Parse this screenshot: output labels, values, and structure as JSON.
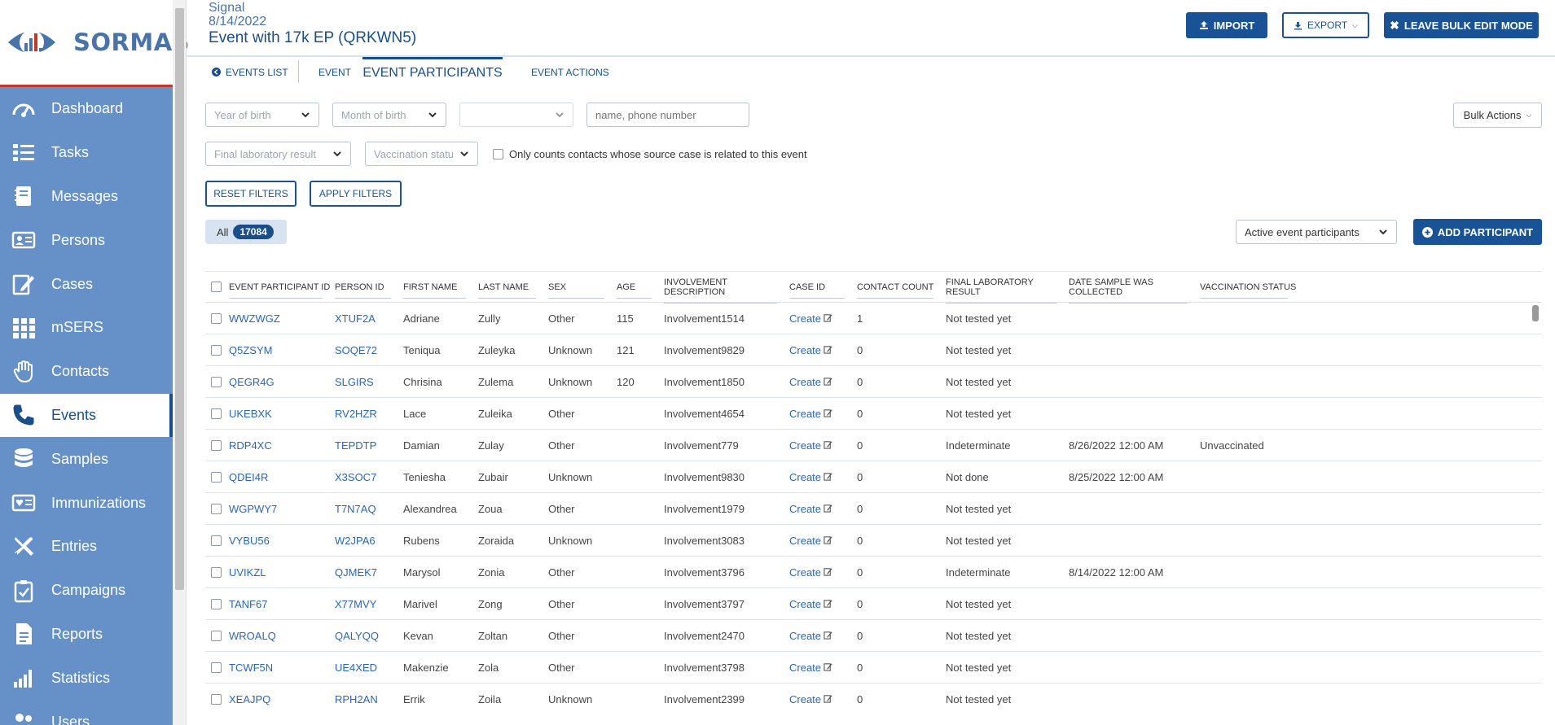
{
  "app": {
    "logo_text": "SORMAS"
  },
  "sidebar": {
    "items": [
      {
        "label": "Dashboard",
        "icon": "gauge-icon"
      },
      {
        "label": "Tasks",
        "icon": "task-list-icon"
      },
      {
        "label": "Messages",
        "icon": "notebook-icon"
      },
      {
        "label": "Persons",
        "icon": "id-card-icon"
      },
      {
        "label": "Cases",
        "icon": "edit-document-icon"
      },
      {
        "label": "mSERS",
        "icon": "grid-icon"
      },
      {
        "label": "Contacts",
        "icon": "hand-icon"
      },
      {
        "label": "Events",
        "icon": "phone-icon"
      },
      {
        "label": "Samples",
        "icon": "database-icon"
      },
      {
        "label": "Immunizations",
        "icon": "heart-card-icon"
      },
      {
        "label": "Entries",
        "icon": "airplane-icon"
      },
      {
        "label": "Campaigns",
        "icon": "clipboard-check-icon"
      },
      {
        "label": "Reports",
        "icon": "report-document-icon"
      },
      {
        "label": "Statistics",
        "icon": "bar-chart-icon"
      },
      {
        "label": "Users",
        "icon": "users-icon"
      }
    ],
    "active_index": 7
  },
  "header": {
    "subtitle_type": "Signal",
    "subtitle_date": "8/14/2022",
    "title": "Event with 17k EP (QRKWN5)",
    "import_label": "IMPORT",
    "export_label": "EXPORT",
    "leave_bulk_label": "LEAVE BULK EDIT MODE"
  },
  "tabs": {
    "events_list": "EVENTS LIST",
    "event": "EVENT",
    "event_participants": "EVENT PARTICIPANTS",
    "event_actions": "EVENT ACTIONS"
  },
  "filters": {
    "year_of_birth": "Year of birth",
    "month_of_birth": "Month of birth",
    "day_of_birth": "",
    "search_placeholder": "name, phone number",
    "bulk_actions": "Bulk Actions",
    "final_lab_result": "Final laboratory result",
    "vaccination_status": "Vaccination statu",
    "only_counts_label": "Only counts contacts whose source case is related to this event",
    "reset_label": "RESET FILTERS",
    "apply_label": "APPLY FILTERS",
    "all_label": "All",
    "all_count": "17084",
    "participant_scope": "Active event participants",
    "add_participant_label": "ADD PARTICIPANT"
  },
  "table": {
    "columns": [
      "EVENT PARTICIPANT ID",
      "PERSON ID",
      "FIRST NAME",
      "LAST NAME",
      "SEX",
      "AGE",
      "INVOLVEMENT DESCRIPTION",
      "CASE ID",
      "CONTACT COUNT",
      "FINAL LABORATORY RESULT",
      "DATE SAMPLE WAS COLLECTED",
      "VACCINATION STATUS"
    ],
    "rows": [
      [
        "WWZWGZ",
        "XTUF2A",
        "Adriane",
        "Zully",
        "Other",
        "115",
        "Involvement1514",
        "Create",
        "1",
        "Not tested yet",
        "",
        ""
      ],
      [
        "Q5ZSYM",
        "SOQE72",
        "Teniqua",
        "Zuleyka",
        "Unknown",
        "121",
        "Involvement9829",
        "Create",
        "0",
        "Not tested yet",
        "",
        ""
      ],
      [
        "QEGR4G",
        "SLGIRS",
        "Chrisina",
        "Zulema",
        "Unknown",
        "120",
        "Involvement1850",
        "Create",
        "0",
        "Not tested yet",
        "",
        ""
      ],
      [
        "UKEBXK",
        "RV2HZR",
        "Lace",
        "Zuleika",
        "Other",
        "",
        "Involvement4654",
        "Create",
        "0",
        "Not tested yet",
        "",
        ""
      ],
      [
        "RDP4XC",
        "TEPDTP",
        "Damian",
        "Zulay",
        "Other",
        "",
        "Involvement779",
        "Create",
        "0",
        "Indeterminate",
        "8/26/2022 12:00 AM",
        "Unvaccinated"
      ],
      [
        "QDEI4R",
        "X3SOC7",
        "Teniesha",
        "Zubair",
        "Unknown",
        "",
        "Involvement9830",
        "Create",
        "0",
        "Not done",
        "8/25/2022 12:00 AM",
        ""
      ],
      [
        "WGPWY7",
        "T7N7AQ",
        "Alexandrea",
        "Zoua",
        "Other",
        "",
        "Involvement1979",
        "Create",
        "0",
        "Not tested yet",
        "",
        ""
      ],
      [
        "VYBU56",
        "W2JPA6",
        "Rubens",
        "Zoraida",
        "Unknown",
        "",
        "Involvement3083",
        "Create",
        "0",
        "Not tested yet",
        "",
        ""
      ],
      [
        "UVIKZL",
        "QJMEK7",
        "Marysol",
        "Zonia",
        "Other",
        "",
        "Involvement3796",
        "Create",
        "0",
        "Indeterminate",
        "8/14/2022 12:00 AM",
        ""
      ],
      [
        "TANF67",
        "X77MVY",
        "Marivel",
        "Zong",
        "Other",
        "",
        "Involvement3797",
        "Create",
        "0",
        "Not tested yet",
        "",
        ""
      ],
      [
        "WROALQ",
        "QALYQQ",
        "Kevan",
        "Zoltan",
        "Other",
        "",
        "Involvement2470",
        "Create",
        "0",
        "Not tested yet",
        "",
        ""
      ],
      [
        "TCWF5N",
        "UE4XED",
        "Makenzie",
        "Zola",
        "Other",
        "",
        "Involvement3798",
        "Create",
        "0",
        "Not tested yet",
        "",
        ""
      ],
      [
        "XEAJPQ",
        "RPH2AN",
        "Errik",
        "Zoila",
        "Unknown",
        "",
        "Involvement2399",
        "Create",
        "0",
        "Not tested yet",
        "",
        ""
      ]
    ]
  }
}
